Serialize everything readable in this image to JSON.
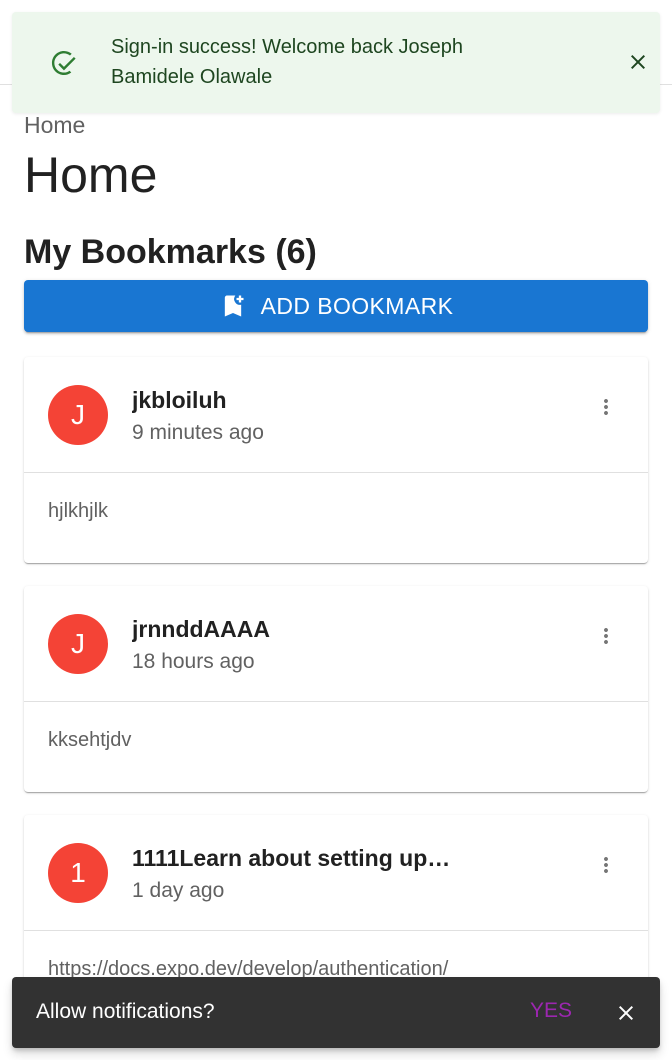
{
  "alert": {
    "message": "Sign-in success! Welcome back Joseph Bamidele Olawale",
    "icon": "check-circle-icon",
    "color": "#2e7d32"
  },
  "breadcrumb": "Home",
  "page_title": "Home",
  "bookmarks": {
    "heading": "My Bookmarks (6)",
    "add_button_label": "ADD BOOKMARK",
    "items": [
      {
        "avatar": "J",
        "title": "jkbloiluh",
        "time": "9 minutes ago",
        "body": "hjlkhjlk"
      },
      {
        "avatar": "J",
        "title": "jrnnddAAAA",
        "time": "18 hours ago",
        "body": "kksehtjdv"
      },
      {
        "avatar": "1",
        "title": "1111Learn about setting up…",
        "time": "1 day ago",
        "body": "https://docs.expo.dev/develop/authentication/"
      }
    ]
  },
  "snackbar": {
    "message": "Allow notifications?",
    "action_label": "YES"
  },
  "colors": {
    "primary": "#1976d2",
    "avatar": "#f44336",
    "alert_bg": "#edf7ed",
    "snackbar_action": "#9c27b0"
  }
}
